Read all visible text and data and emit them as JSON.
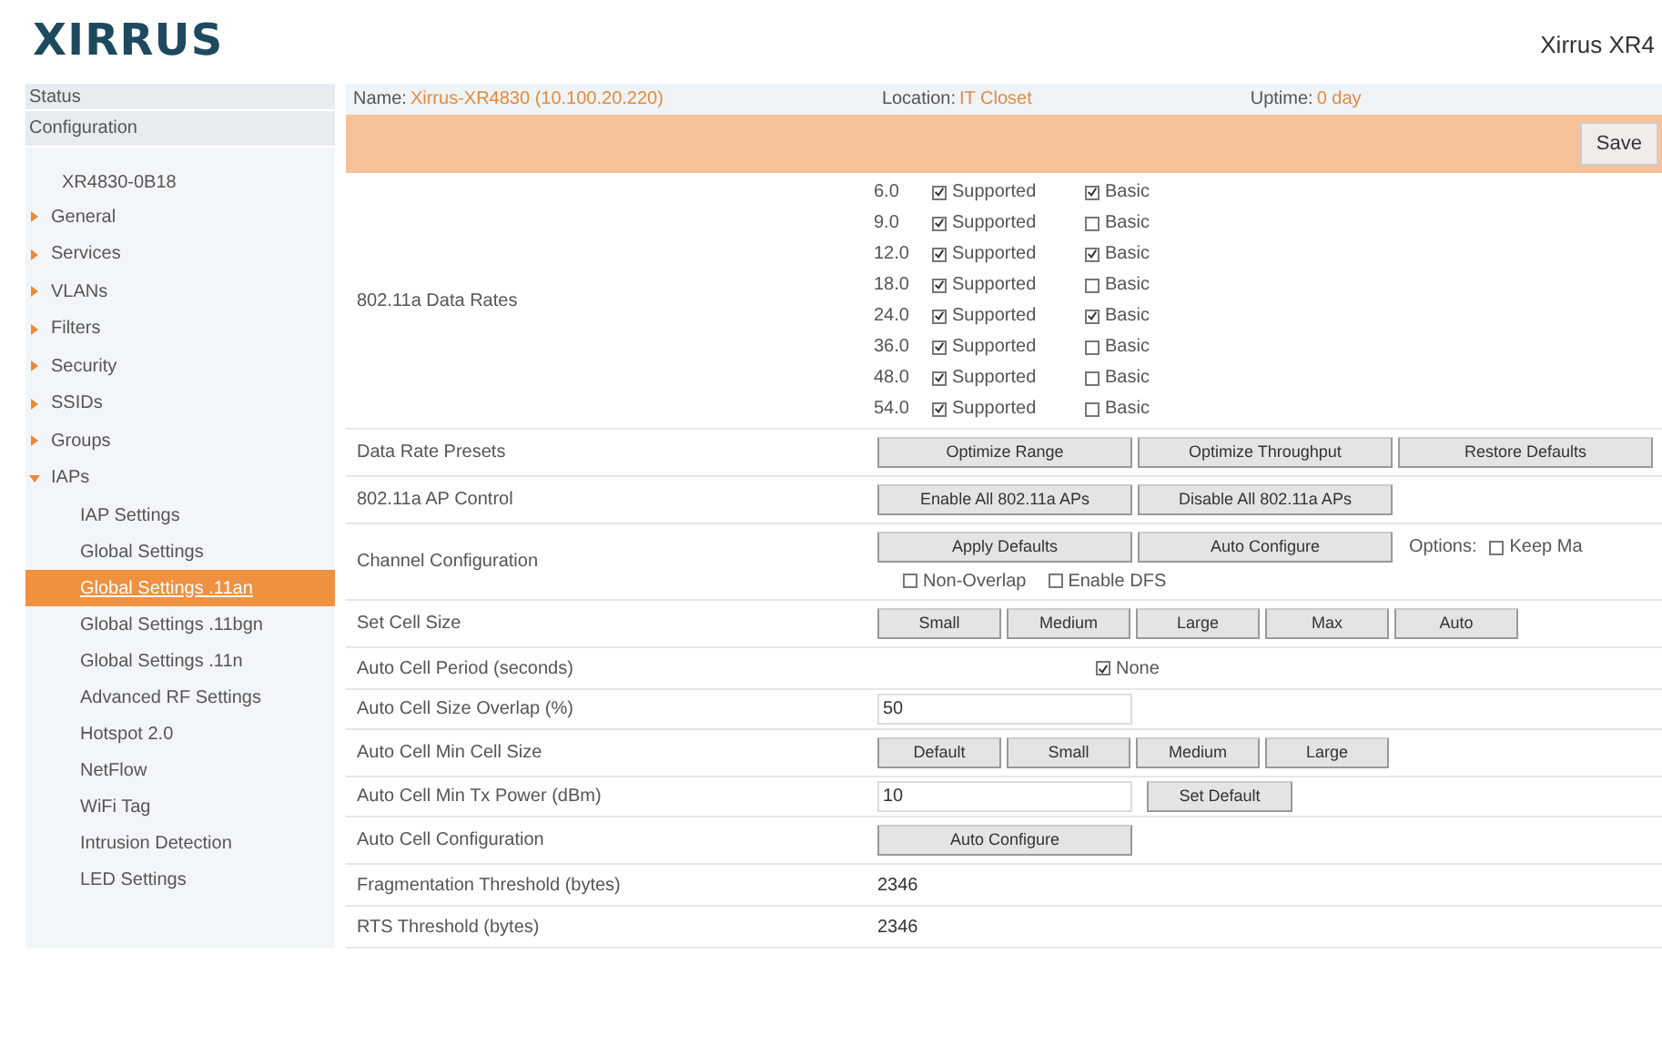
{
  "logo": "XIRRUS",
  "title": "Xirrus XR4",
  "sidebar": [
    {
      "label": "Status",
      "kind": "top",
      "selected": false
    },
    {
      "label": "Configuration",
      "kind": "top",
      "selected": false
    },
    {
      "label": "XR4830-0B18",
      "kind": "host",
      "selected": false
    },
    {
      "label": "General",
      "kind": "group",
      "expanded": false,
      "selected": false
    },
    {
      "label": "Services",
      "kind": "group",
      "expanded": false,
      "selected": false
    },
    {
      "label": "VLANs",
      "kind": "group",
      "expanded": false,
      "selected": false
    },
    {
      "label": "Filters",
      "kind": "group",
      "expanded": false,
      "selected": false
    },
    {
      "label": "Security",
      "kind": "group",
      "expanded": false,
      "selected": false
    },
    {
      "label": "SSIDs",
      "kind": "group",
      "expanded": false,
      "selected": false
    },
    {
      "label": "Groups",
      "kind": "group",
      "expanded": false,
      "selected": false
    },
    {
      "label": "IAPs",
      "kind": "group",
      "expanded": true,
      "selected": false,
      "children": [
        {
          "label": "IAP Settings",
          "selected": false
        },
        {
          "label": "Global Settings",
          "selected": false
        },
        {
          "label": "Global Settings .11an",
          "selected": true
        },
        {
          "label": "Global Settings .11bgn",
          "selected": false
        },
        {
          "label": "Global Settings .11n",
          "selected": false
        },
        {
          "label": "Advanced RF Settings",
          "selected": false
        },
        {
          "label": "Hotspot 2.0",
          "selected": false
        },
        {
          "label": "NetFlow",
          "selected": false
        },
        {
          "label": "WiFi Tag",
          "selected": false
        },
        {
          "label": "Intrusion Detection",
          "selected": false
        },
        {
          "label": "LED Settings",
          "selected": false
        }
      ]
    }
  ],
  "info": {
    "name_label": "Name:",
    "name": "Xirrus-XR4830 (10.100.20.220)",
    "location_label": "Location:",
    "location": "IT Closet",
    "uptime_label": "Uptime:",
    "uptime": "0 day"
  },
  "save_button": "Save",
  "rows": [
    {
      "kind": "rates",
      "label": "802.11a Data Rates",
      "rates": [
        {
          "rate": "6.0",
          "supported_label": "Supported",
          "supported": true,
          "basic_label": "Basic",
          "basic": true
        },
        {
          "rate": "9.0",
          "supported_label": "Supported",
          "supported": true,
          "basic_label": "Basic",
          "basic": false
        },
        {
          "rate": "12.0",
          "supported_label": "Supported",
          "supported": true,
          "basic_label": "Basic",
          "basic": true
        },
        {
          "rate": "18.0",
          "supported_label": "Supported",
          "supported": true,
          "basic_label": "Basic",
          "basic": false
        },
        {
          "rate": "24.0",
          "supported_label": "Supported",
          "supported": true,
          "basic_label": "Basic",
          "basic": true
        },
        {
          "rate": "36.0",
          "supported_label": "Supported",
          "supported": true,
          "basic_label": "Basic",
          "basic": false
        },
        {
          "rate": "48.0",
          "supported_label": "Supported",
          "supported": true,
          "basic_label": "Basic",
          "basic": false
        },
        {
          "rate": "54.0",
          "supported_label": "Supported",
          "supported": true,
          "basic_label": "Basic",
          "basic": false
        }
      ]
    },
    {
      "kind": "buttons",
      "label": "Data Rate Presets",
      "buttons": [
        "Optimize Range",
        "Optimize Throughput",
        "Restore Defaults"
      ]
    },
    {
      "kind": "buttons",
      "label": "802.11a AP Control",
      "buttons": [
        "Enable All 802.11a APs",
        "Disable All 802.11a APs"
      ]
    },
    {
      "kind": "channel",
      "label": "Channel Configuration",
      "buttons": [
        "Apply Defaults",
        "Auto Configure"
      ],
      "options_label": "Options:",
      "options": [
        {
          "label": "Keep Ma",
          "checked": false
        },
        {
          "label": "Non-Overlap",
          "checked": false
        },
        {
          "label": "Enable DFS",
          "checked": false
        }
      ]
    },
    {
      "kind": "buttons",
      "label": "Set Cell Size",
      "buttons": [
        "Small",
        "Medium",
        "Large",
        "Max",
        "Auto"
      ]
    },
    {
      "kind": "checkbox",
      "label": "Auto Cell Period (seconds)",
      "option": {
        "label": "None",
        "checked": true
      }
    },
    {
      "kind": "input",
      "label": "Auto Cell Size Overlap (%)",
      "value": "50"
    },
    {
      "kind": "buttons",
      "label": "Auto Cell Min Cell Size",
      "buttons": [
        "Default",
        "Small",
        "Medium",
        "Large"
      ]
    },
    {
      "kind": "input_button",
      "label": "Auto Cell Min Tx Power (dBm)",
      "value": "10",
      "button": "Set Default"
    },
    {
      "kind": "buttons",
      "label": "Auto Cell Configuration",
      "buttons": [
        "Auto Configure"
      ]
    },
    {
      "kind": "text",
      "label": "Fragmentation Threshold (bytes)",
      "value": "2346"
    },
    {
      "kind": "text",
      "label": "RTS Threshold (bytes)",
      "value": "2346"
    }
  ]
}
